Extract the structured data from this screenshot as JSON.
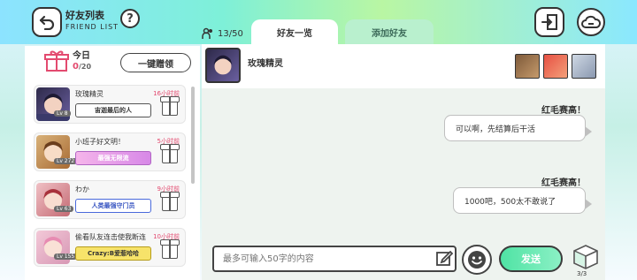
{
  "header": {
    "title_cn": "好友列表",
    "title_en": "FRIEND LIST",
    "help_label": "?",
    "friend_count": "13/50"
  },
  "tabs": [
    {
      "label": "好友一览",
      "active": true
    },
    {
      "label": "添加好友",
      "active": false
    }
  ],
  "daily": {
    "label": "今日",
    "count": "0",
    "max": "/20",
    "gift_all_label": "一键赠领"
  },
  "friends": [
    {
      "name": "玫瑰精灵",
      "time": "16小时前",
      "level": "Lv 8",
      "plate": "宙迦最后的人",
      "plate_color": "#ffffff"
    },
    {
      "name": "小班子好文明！",
      "time": "5小时前",
      "level": "Lv 272",
      "plate": "最强无限流",
      "plate_color": "#f1a8e8"
    },
    {
      "name": "わか",
      "time": "9小时前",
      "level": "Lv 63",
      "plate": "人类最强守门员",
      "plate_color": "#ffffff"
    },
    {
      "name": "偷看队友连击使我断连",
      "time": "10小时前",
      "level": "Lv 155",
      "plate": "Crazy:B爱惹哈哈",
      "plate_color": "#f7e36a"
    }
  ],
  "chat": {
    "name": "玫瑰精灵",
    "messages": [
      {
        "sender": "红毛赛高！",
        "text": "可以啊，先结算后干活"
      },
      {
        "sender": "红毛赛高！",
        "text": "1000吧，500太不敢说了"
      }
    ],
    "input_placeholder": "最多可输入50字的内容",
    "send_label": "发送",
    "stamp_count": "3/3"
  },
  "colors": {
    "accent_green": "#4fe3a4",
    "time_pink": "#e34a6f"
  }
}
